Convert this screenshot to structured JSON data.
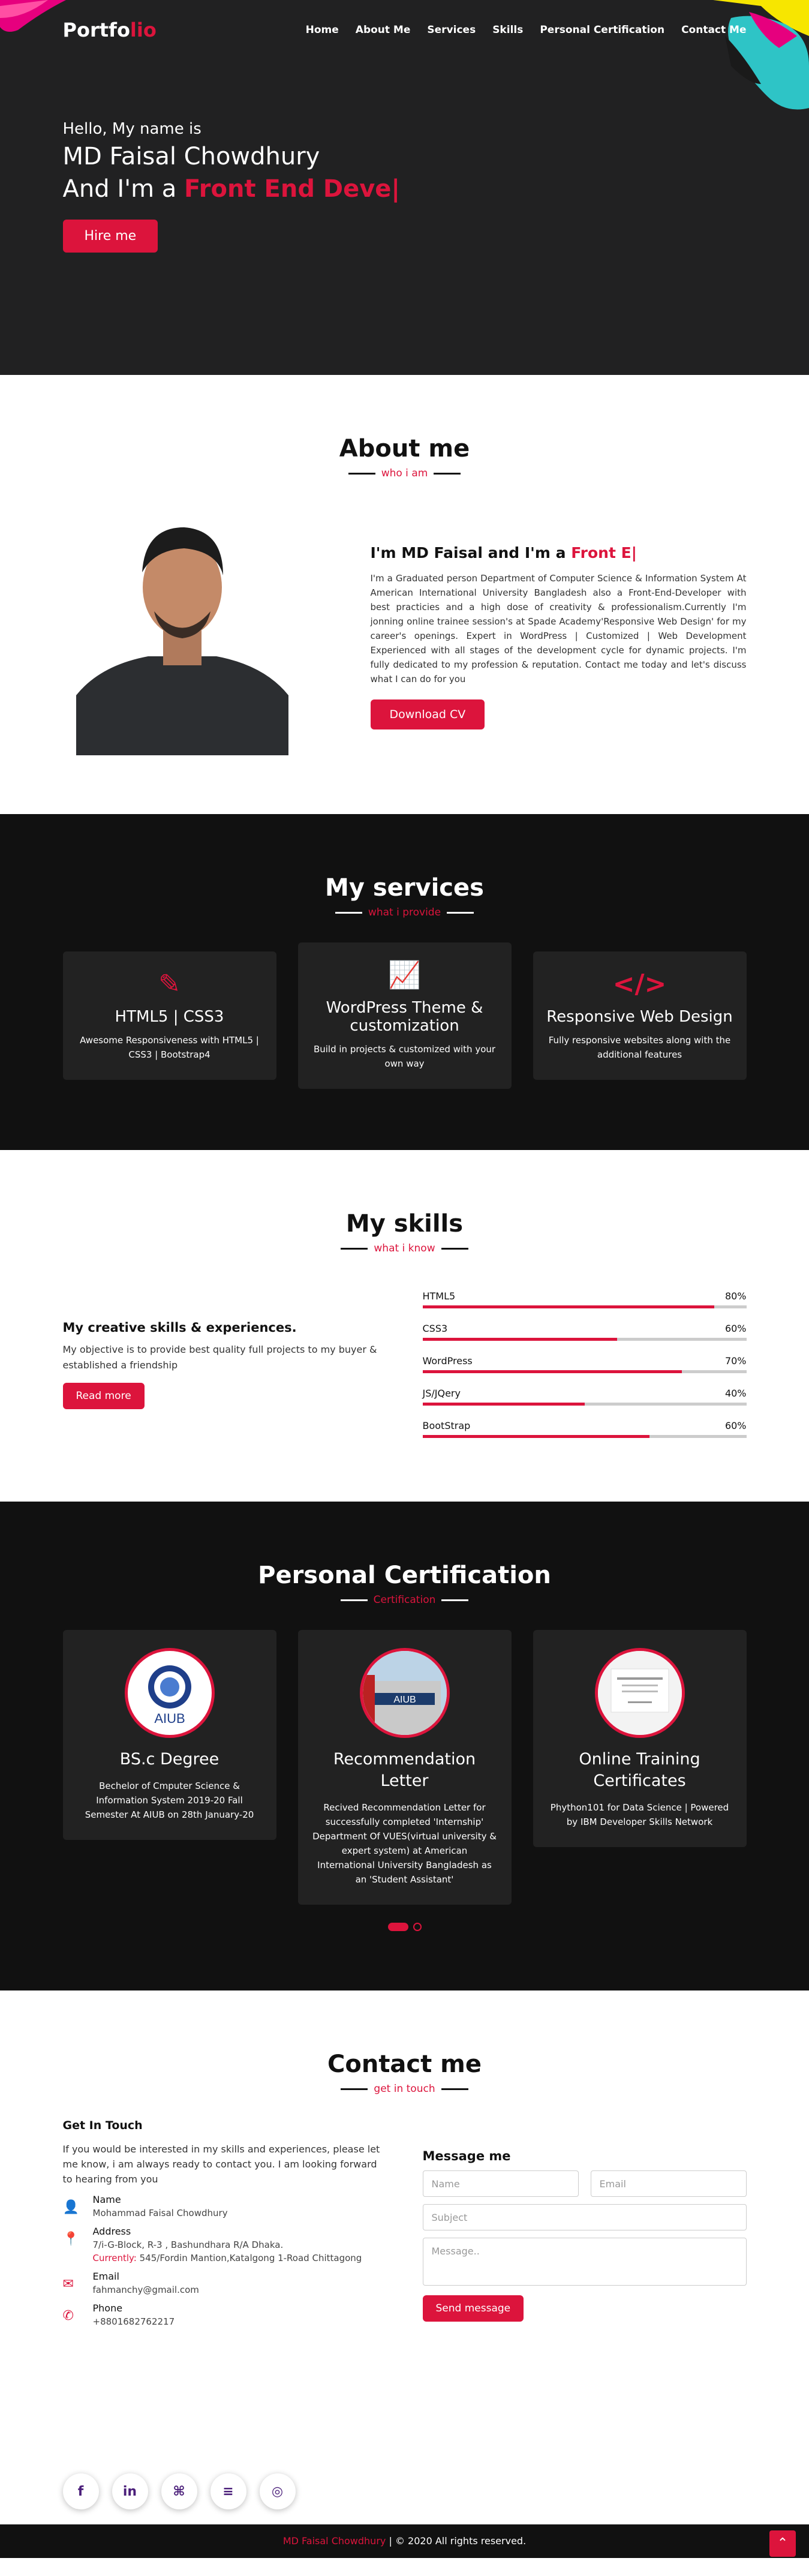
{
  "nav": {
    "logo_a": "Portfo",
    "logo_b": "lio",
    "items": [
      "Home",
      "About Me",
      "Services",
      "Skills",
      "Personal Certification",
      "Contact Me"
    ]
  },
  "hero": {
    "hello": "Hello, My name is",
    "name": "MD Faisal Chowdhury",
    "role_prefix": "And I'm a",
    "role_typed": "Front End Deve|",
    "button": "Hire me"
  },
  "about": {
    "title": "About me",
    "subtitle": "who i am",
    "heading": "I'm MD Faisal and I'm a",
    "heading_typed": "Front E|",
    "body": "I'm a Graduated person Department of Computer Science & Information System At American International University Bangladesh also a Front-End-Developer with best practicies and a high dose of creativity & professionalism.Currently I'm jonning online trainee session's at Spade Academy'Responsive Web Design' for my career's openings. Expert in WordPress | Customized | Web Development Experienced with all stages of the development cycle for dynamic projects. I'm fully dedicated to my profession & reputation. Contact me today and let's discuss what I can do for you",
    "button": "Download CV"
  },
  "services": {
    "title": "My services",
    "subtitle": "what i provide",
    "cards": [
      {
        "icon": "paint-brush-icon",
        "title": "HTML5 | CSS3",
        "text": "Awesome Responsiveness with HTML5 | CSS3 | Bootstrap4"
      },
      {
        "icon": "chart-line-icon",
        "title": "WordPress Theme & customization",
        "text": "Build in projects & customized with your own way"
      },
      {
        "icon": "code-icon",
        "title": "Responsive Web Design",
        "text": "Fully responsive websites along with the additional features"
      }
    ]
  },
  "skills": {
    "title": "My skills",
    "subtitle": "what i know",
    "heading": "My creative skills & experiences.",
    "text": "My objective is to provide best quality full projects to my buyer & established a friendship",
    "button": "Read more",
    "bars": [
      {
        "name": "HTML5",
        "label": "80%",
        "value": 90
      },
      {
        "name": "CSS3",
        "label": "60%",
        "value": 60
      },
      {
        "name": "WordPress",
        "label": "70%",
        "value": 80
      },
      {
        "name": "JS/JQery",
        "label": "40%",
        "value": 50
      },
      {
        "name": "BootStrap",
        "label": "60%",
        "value": 70
      }
    ]
  },
  "certs": {
    "title": "Personal Certification",
    "subtitle": "Certification",
    "cards": [
      {
        "title": "BS.c Degree",
        "text": "Bechelor of Cmputer Science & Information System 2019-20 Fall Semester At AIUB on 28th January-20",
        "badge": "AIUB"
      },
      {
        "title": "Recommendation Letter",
        "text": "Recived Recommendation Letter for successfully completed 'Internship' Department Of VUES(virtual university & expert system) at American International University Bangladesh as an 'Student Assistant'",
        "badge": "AIUB"
      },
      {
        "title": "Online Training Certificates",
        "text": "Phython101 for Data Science | Powered by IBM Developer Skills Network",
        "badge": ""
      }
    ]
  },
  "contact": {
    "title": "Contact me",
    "subtitle": "get in touch",
    "heading": "Get In Touch",
    "text": "If you would be interested in my skills and experiences, please let me know, i am always ready to contact you. I am looking forward to hearing from you",
    "name_label": "Name",
    "name": "Mohammad Faisal Chowdhury",
    "addr_label": "Address",
    "addr1": "7/i-G-Block, R-3 , Bashundhara R/A Dhaka.",
    "addr2_label": "Currently:",
    "addr2": "545/Fordin Mantion,Katalgong 1-Road Chittagong",
    "email_label": "Email",
    "email": "fahmanchy@gmail.com",
    "phone_label": "Phone",
    "phone": "+8801682762217",
    "form_title": "Message me",
    "ph_name": "Name",
    "ph_email": "Email",
    "ph_subject": "Subject",
    "ph_message": "Message..",
    "button": "Send message"
  },
  "footer": {
    "name": "MD Faisal Chowdhury",
    "text": " | © 2020 All rights reserved."
  }
}
